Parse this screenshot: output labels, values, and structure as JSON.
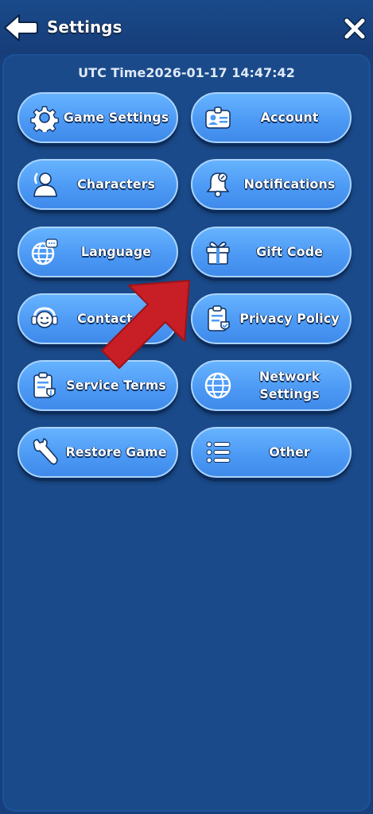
{
  "header": {
    "title": "Settings"
  },
  "utc_time": "UTC Time2026-01-17 14:47:42",
  "buttons": [
    {
      "label": "Game Settings",
      "icon": "gear-icon"
    },
    {
      "label": "Account",
      "icon": "id-card-icon"
    },
    {
      "label": "Characters",
      "icon": "person-icon"
    },
    {
      "label": "Notifications",
      "icon": "bell-icon"
    },
    {
      "label": "Language",
      "icon": "globe-chat-icon"
    },
    {
      "label": "Gift Code",
      "icon": "gift-icon"
    },
    {
      "label": "Contact Us",
      "icon": "headset-icon"
    },
    {
      "label": "Privacy Policy",
      "icon": "clipboard-check-icon"
    },
    {
      "label": "Service Terms",
      "icon": "clipboard-shield-icon"
    },
    {
      "label": "Network Settings",
      "icon": "globe-icon"
    },
    {
      "label": "Restore Game",
      "icon": "wrench-icon"
    },
    {
      "label": "Other",
      "icon": "list-icon"
    }
  ],
  "colors": {
    "background": "#173f7c",
    "button": "#4d9af5",
    "arrow": "#c81e25"
  }
}
